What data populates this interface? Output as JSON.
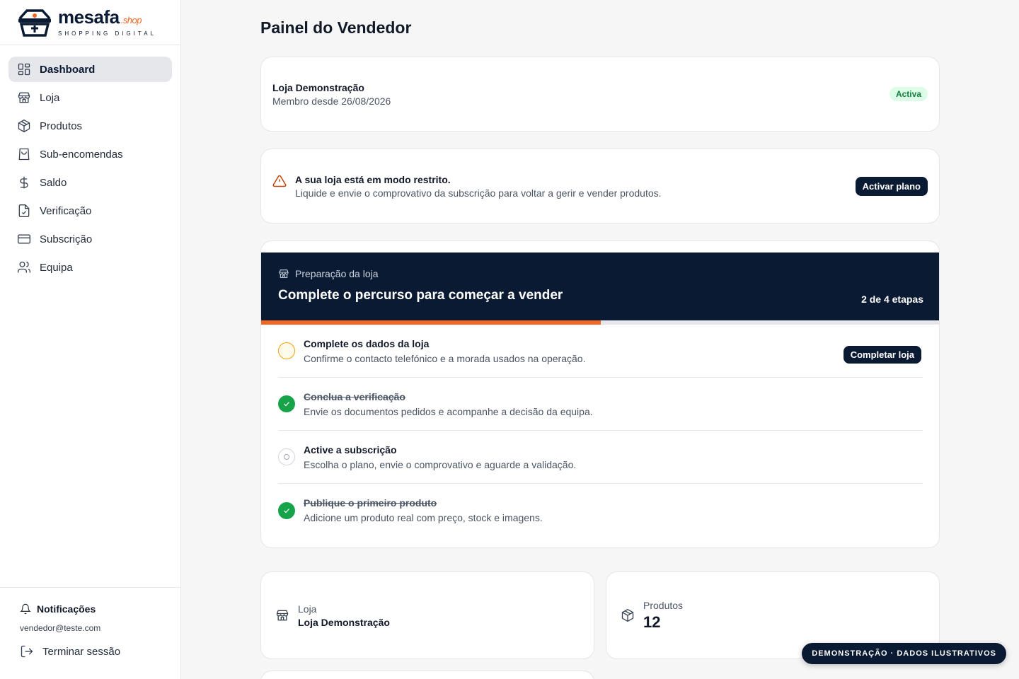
{
  "brand": {
    "name": "mesafa",
    "suffix": ".shop",
    "tagline": "SHOPPING DIGITAL",
    "accent": "#f26522",
    "primary": "#0b1a33"
  },
  "sidebar": {
    "items": [
      {
        "label": "Dashboard",
        "icon": "dashboard-icon",
        "active": true
      },
      {
        "label": "Loja",
        "icon": "store-icon"
      },
      {
        "label": "Produtos",
        "icon": "box-icon"
      },
      {
        "label": "Sub-encomendas",
        "icon": "bag-icon"
      },
      {
        "label": "Saldo",
        "icon": "dollar-icon"
      },
      {
        "label": "Verificação",
        "icon": "file-check-icon"
      },
      {
        "label": "Subscrição",
        "icon": "credit-card-icon"
      },
      {
        "label": "Equipa",
        "icon": "users-icon"
      }
    ],
    "notifications": "Notificações",
    "email": "vendedor@teste.com",
    "logout": "Terminar sessão"
  },
  "page": {
    "title": "Painel do Vendedor"
  },
  "store": {
    "name": "Loja Demonstração",
    "since": "Membro desde 26/08/2026",
    "status": "Activa"
  },
  "warning": {
    "title": "A sua loja está em modo restrito.",
    "description": "Liquide e envie o comprovativo da subscrição para voltar a gerir e vender produtos.",
    "button": "Activar plano"
  },
  "setup": {
    "label": "Preparação da loja",
    "title": "Complete o percurso para começar a vender",
    "progress_text": "2 de 4 etapas",
    "progress": 0.5,
    "steps": [
      {
        "title": "Complete os dados da loja",
        "description": "Confirme o contacto telefónico e a morada usados na operação.",
        "status": "pending",
        "button": "Completar loja"
      },
      {
        "title": "Conclua a verificação",
        "description": "Envie os documentos pedidos e acompanhe a decisão da equipa.",
        "status": "done"
      },
      {
        "title": "Active a subscrição",
        "description": "Escolha o plano, envie o comprovativo e aguarde a validação.",
        "status": "todo"
      },
      {
        "title": "Publique o primeiro produto",
        "description": "Adicione um produto real com preço, stock e imagens.",
        "status": "done"
      }
    ]
  },
  "stats": {
    "store": {
      "label": "Loja",
      "value": "Loja Demonstração"
    },
    "products": {
      "label": "Produtos",
      "value": "12"
    }
  },
  "demo_badge": "DEMONSTRAÇÃO · DADOS ILUSTRATIVOS"
}
